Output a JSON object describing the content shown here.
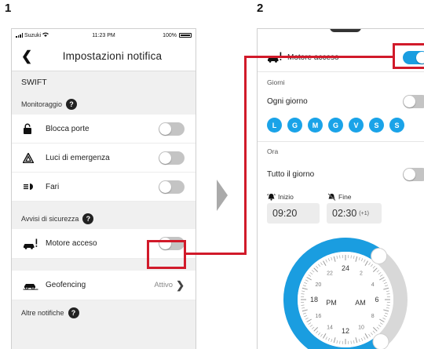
{
  "steps": {
    "one": "1",
    "two": "2"
  },
  "phone1": {
    "status": {
      "carrier": "Suzuki",
      "time": "11:23 PM",
      "battery": "100%"
    },
    "nav_title": "Impostazioni notifica",
    "vehicle": "SWIFT",
    "monitoring": {
      "header": "Monitoraggio",
      "items": [
        {
          "label": "Blocca porte",
          "icon": "lock-icon",
          "on": false
        },
        {
          "label": "Luci di emergenza",
          "icon": "hazard-warning-icon",
          "on": false
        },
        {
          "label": "Fari",
          "icon": "headlight-icon",
          "on": false
        }
      ]
    },
    "security": {
      "header": "Avvisi di sicurezza",
      "items": [
        {
          "label": "Motore acceso",
          "icon": "engine-on-car-icon",
          "on": false
        }
      ]
    },
    "geofencing": {
      "label": "Geofencing",
      "value": "Attivo",
      "icon": "geofence-car-icon"
    },
    "other": {
      "header": "Altre notifiche"
    },
    "help_glyph": "?"
  },
  "phone2": {
    "engine_label": "Motore acceso",
    "engine_on": true,
    "days_header": "Giorni",
    "every_day_label": "Ogni giorno",
    "days": [
      "L",
      "G",
      "M",
      "G",
      "V",
      "S",
      "S"
    ],
    "time_header": "Ora",
    "all_day_label": "Tutto il giorno",
    "start": {
      "label": "Inizio",
      "value": "09:20",
      "icon": "alarm-bell-icon"
    },
    "end": {
      "label": "Fine",
      "value": "02:30",
      "suffix": "(+1)",
      "icon": "alarm-off-icon"
    },
    "clock": {
      "pm": "PM",
      "am": "AM",
      "numbers": [
        "24",
        "2",
        "4",
        "6",
        "8",
        "10",
        "12",
        "14",
        "16",
        "18",
        "20",
        "22"
      ]
    }
  },
  "colors": {
    "accent": "#1a9de0",
    "highlight": "#d11a2a",
    "toggle_off": "#c4c4c4"
  }
}
